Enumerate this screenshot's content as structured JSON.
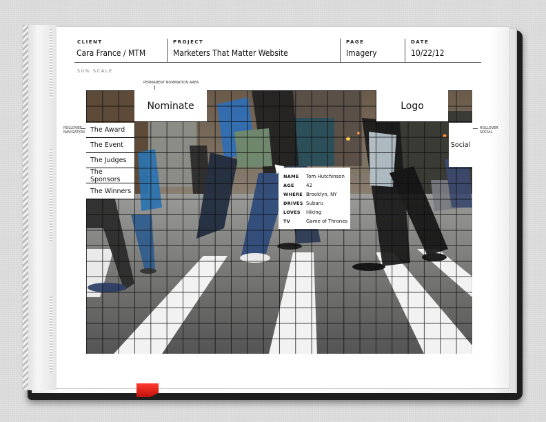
{
  "header": {
    "client_label": "CLIENT",
    "client_value": "Cara France / MTM",
    "project_label": "PROJECT",
    "project_value": "Marketers That Matter Website",
    "page_label": "PAGE",
    "page_value": "Imagery",
    "date_label": "DATE",
    "date_value": "10/22/12"
  },
  "scale": "50% SCALE",
  "annotations": {
    "nomination_area": "PERMANENT NOMINATION AREA",
    "rollover_nav_line1": "ROLLOVER",
    "rollover_nav_line2": "NAVIGATION",
    "rollover_social_line1": "ROLLOVER",
    "rollover_social_line2": "SOCIAL"
  },
  "mockup": {
    "nominate": "Nominate",
    "logo": "Logo",
    "social": "Social",
    "nav": [
      "The Award",
      "The Event",
      "The Judges",
      "The Sponsors",
      "The Winners"
    ]
  },
  "profile": [
    {
      "key": "NAME",
      "value": "Tom Hutchinson"
    },
    {
      "key": "AGE",
      "value": "42"
    },
    {
      "key": "WHERE",
      "value": "Brooklyn, NY"
    },
    {
      "key": "DRIVES",
      "value": "Subaru"
    },
    {
      "key": "LOVES",
      "value": "Hiking"
    },
    {
      "key": "TV",
      "value": "Game of Thrones"
    }
  ],
  "colors": {
    "ribbon": "#e0231b",
    "book_cover": "#1e1e1e"
  }
}
